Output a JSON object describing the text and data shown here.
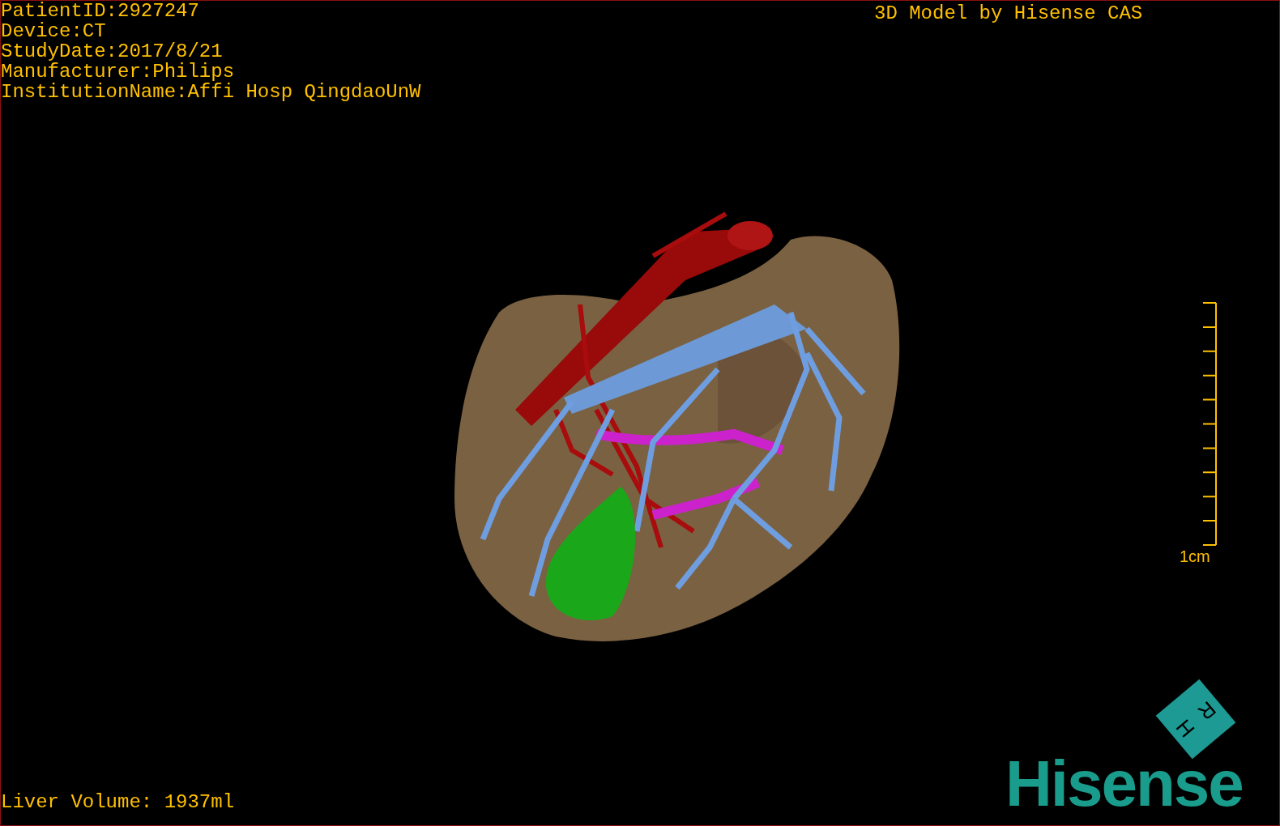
{
  "study_info": [
    "PatientID:2927247",
    "Device:CT",
    "StudyDate:2017/8/21",
    "Manufacturer:Philips",
    "InstitutionName:Affi Hosp QingdaoUnW"
  ],
  "model_credit": "3D Model by Hisense CAS",
  "scale_bar": {
    "label": "1cm"
  },
  "orientation_cube": {
    "labels": [
      "H",
      "R"
    ]
  },
  "liver_volume": "Liver Volume: 1937ml",
  "brand": "Hisense"
}
